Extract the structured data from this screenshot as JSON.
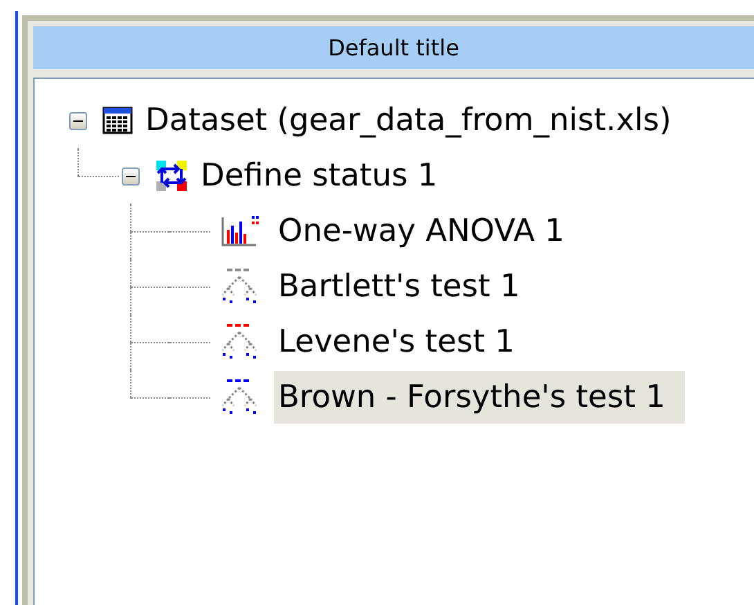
{
  "header": {
    "title": "Default title"
  },
  "tree": [
    {
      "label": "Dataset (gear_data_from_nist.xls)",
      "kind": "dataset",
      "expanded": true,
      "selected": false,
      "children": [
        {
          "label": "Define status 1",
          "kind": "status",
          "expanded": true,
          "selected": false,
          "children": [
            {
              "label": "One-way ANOVA 1",
              "kind": "chart",
              "selected": false
            },
            {
              "label": "Bartlett's test 1",
              "kind": "test",
              "color": "#8c8c8c",
              "selected": false
            },
            {
              "label": "Levene's test 1",
              "kind": "test",
              "color": "#ff0000",
              "selected": false
            },
            {
              "label": "Brown - Forsythe's test 1",
              "kind": "test",
              "color": "#0000ff",
              "selected": true
            }
          ]
        }
      ]
    }
  ]
}
